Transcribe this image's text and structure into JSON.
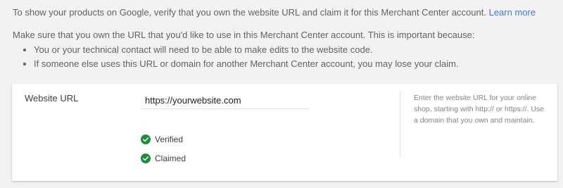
{
  "intro": {
    "text": "To show your products on Google, verify that you own the website URL and claim it for this Merchant Center account.",
    "link": "Learn more"
  },
  "note": {
    "lead": "Make sure that you own the URL that you'd like to use in this Merchant Center account. This is important because:",
    "bullets": [
      "You or your technical contact will need to be able to make edits to the website code.",
      "If someone else uses this URL or domain for another Merchant Center account, you may lose your claim."
    ]
  },
  "form": {
    "field_label": "Website URL",
    "url_value": "https://yourwebsite.com",
    "statuses": [
      {
        "icon": "check-circle-icon",
        "label": "Verified"
      },
      {
        "icon": "check-circle-icon",
        "label": "Claimed"
      }
    ],
    "help_text": "Enter the website URL for your online shop, starting with http:// or https://. Use a domain that you own and maintain."
  },
  "colors": {
    "link": "#4a76d9",
    "success": "#1e8e3e",
    "background": "#f2f2f2"
  }
}
